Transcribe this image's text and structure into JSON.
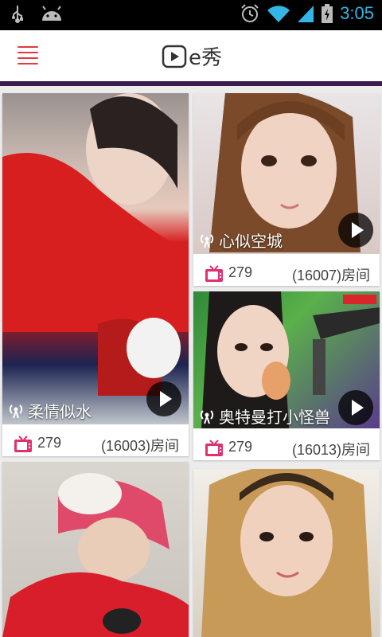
{
  "status_bar": {
    "time": "3:05",
    "icons": [
      "usb-icon",
      "android-icon",
      "alarm-icon",
      "wifi-icon",
      "signal-icon",
      "battery-icon"
    ]
  },
  "header": {
    "title": "e秀",
    "menu_icon": "hamburger-menu-icon",
    "logo_icon": "play-logo-icon"
  },
  "colors": {
    "accent": "#e23a3a",
    "header_divider": "#3b1a4c",
    "tv_icon": "#e0306f",
    "status_time": "#33b5e5"
  },
  "cards": [
    {
      "name": "柔情似水",
      "viewers": "279",
      "room": "(16003)房间"
    },
    {
      "name": "心似空城",
      "viewers": "279",
      "room": "(16007)房间"
    },
    {
      "name": "奥特曼打小怪兽",
      "viewers": "279",
      "room": "(16013)房间"
    },
    {
      "name": "",
      "viewers": "",
      "room": ""
    },
    {
      "name": "",
      "viewers": "",
      "room": ""
    }
  ]
}
